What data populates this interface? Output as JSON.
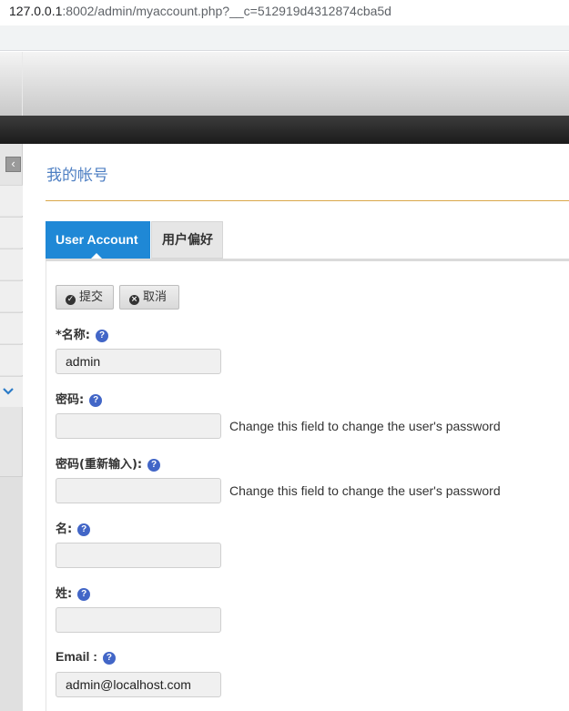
{
  "browser": {
    "url_host": "127.0.0.1",
    "url_rest": ":8002/admin/myaccount.php?__c=512919d4312874cba5d"
  },
  "sidebar": {
    "collapse_icon": "chevron-left-icon",
    "expand_icon": "chevron-down-icon"
  },
  "page": {
    "title": "我的帐号"
  },
  "tabs": [
    {
      "label": "User Account",
      "active": true
    },
    {
      "label": "用户偏好",
      "active": false
    }
  ],
  "toolbar": {
    "submit_label": "提交",
    "cancel_label": "取消"
  },
  "form": {
    "name_label": "*名称:",
    "name_value": "admin",
    "password_label": "密码:",
    "password_value": "",
    "password_hint": "Change this field to change the user's password",
    "password2_label": "密码(重新输入):",
    "password2_value": "",
    "password2_hint": "Change this field to change the user's password",
    "firstname_label": "名:",
    "firstname_value": "",
    "lastname_label": "姓:",
    "lastname_value": "",
    "email_label": "Email :",
    "email_value": "admin@localhost.com",
    "help_glyph": "?"
  },
  "colors": {
    "accent": "#1f88d6",
    "title": "#4e7fc3",
    "rule": "#d9a84a",
    "help": "#4266c7"
  }
}
